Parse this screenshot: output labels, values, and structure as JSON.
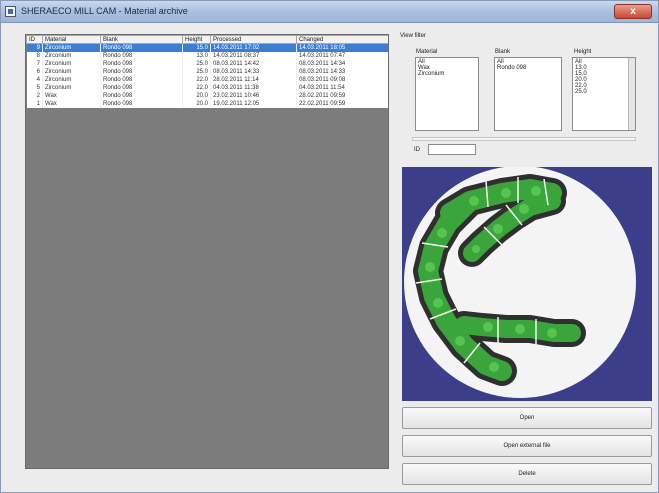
{
  "window": {
    "title": "SHERAECO MILL CAM - Material archive",
    "close_glyph": "x"
  },
  "list": {
    "columns": [
      "ID",
      "Material",
      "Blank",
      "Height",
      "Processed",
      "Changed"
    ],
    "rows": [
      [
        "9",
        "Zirconium",
        "Rondo 098",
        "15.0",
        "14.03.2011 17:02",
        "14.03.2011 18:05"
      ],
      [
        "8",
        "Zirconium",
        "Rondo 098",
        "13.0",
        "14.03.2011 08:37",
        "14.03.2011 07:47"
      ],
      [
        "7",
        "Zirconium",
        "Rondo 098",
        "25.0",
        "08.03.2011 14:42",
        "08.03.2011 14:34"
      ],
      [
        "6",
        "Zirconium",
        "Rondo 098",
        "25.0",
        "08.03.2011 14:33",
        "08.03.2011 14:33"
      ],
      [
        "4",
        "Zirconium",
        "Rondo 098",
        "22.0",
        "28.02.2011 11:14",
        "08.03.2011 09:08"
      ],
      [
        "5",
        "Zirconium",
        "Rondo 098",
        "22.0",
        "04.03.2011 11:38",
        "04.03.2011 11:54"
      ],
      [
        "2",
        "Wax",
        "Rondo 098",
        "20.0",
        "23.02.2011 10:46",
        "28.02.2011 09:59"
      ],
      [
        "1",
        "Wax",
        "Rondo 098",
        "20.0",
        "19.02.2011 12:05",
        "22.02.2011 09:59"
      ]
    ]
  },
  "view_filter": {
    "title": "View filter",
    "material": {
      "label": "Material",
      "options": [
        "All",
        "Wax",
        "Zirconium"
      ]
    },
    "blank": {
      "label": "Blank",
      "options": [
        "All",
        "Rondo 098"
      ]
    },
    "height": {
      "label": "Height",
      "options": [
        "All",
        "13.0",
        "15.0",
        "20.0",
        "22.0",
        "25.0"
      ]
    },
    "id_label": "ID",
    "id_value": ""
  },
  "buttons": {
    "open": "Open",
    "open_external": "Open external file",
    "delete": "Delete"
  },
  "colors": {
    "selection": "#3a7fd4",
    "preview_background": "#3b3f8a",
    "disc": "#f4f4f4",
    "milled_dark": "#2f2f2f",
    "milled_green": "#3aa53a"
  }
}
